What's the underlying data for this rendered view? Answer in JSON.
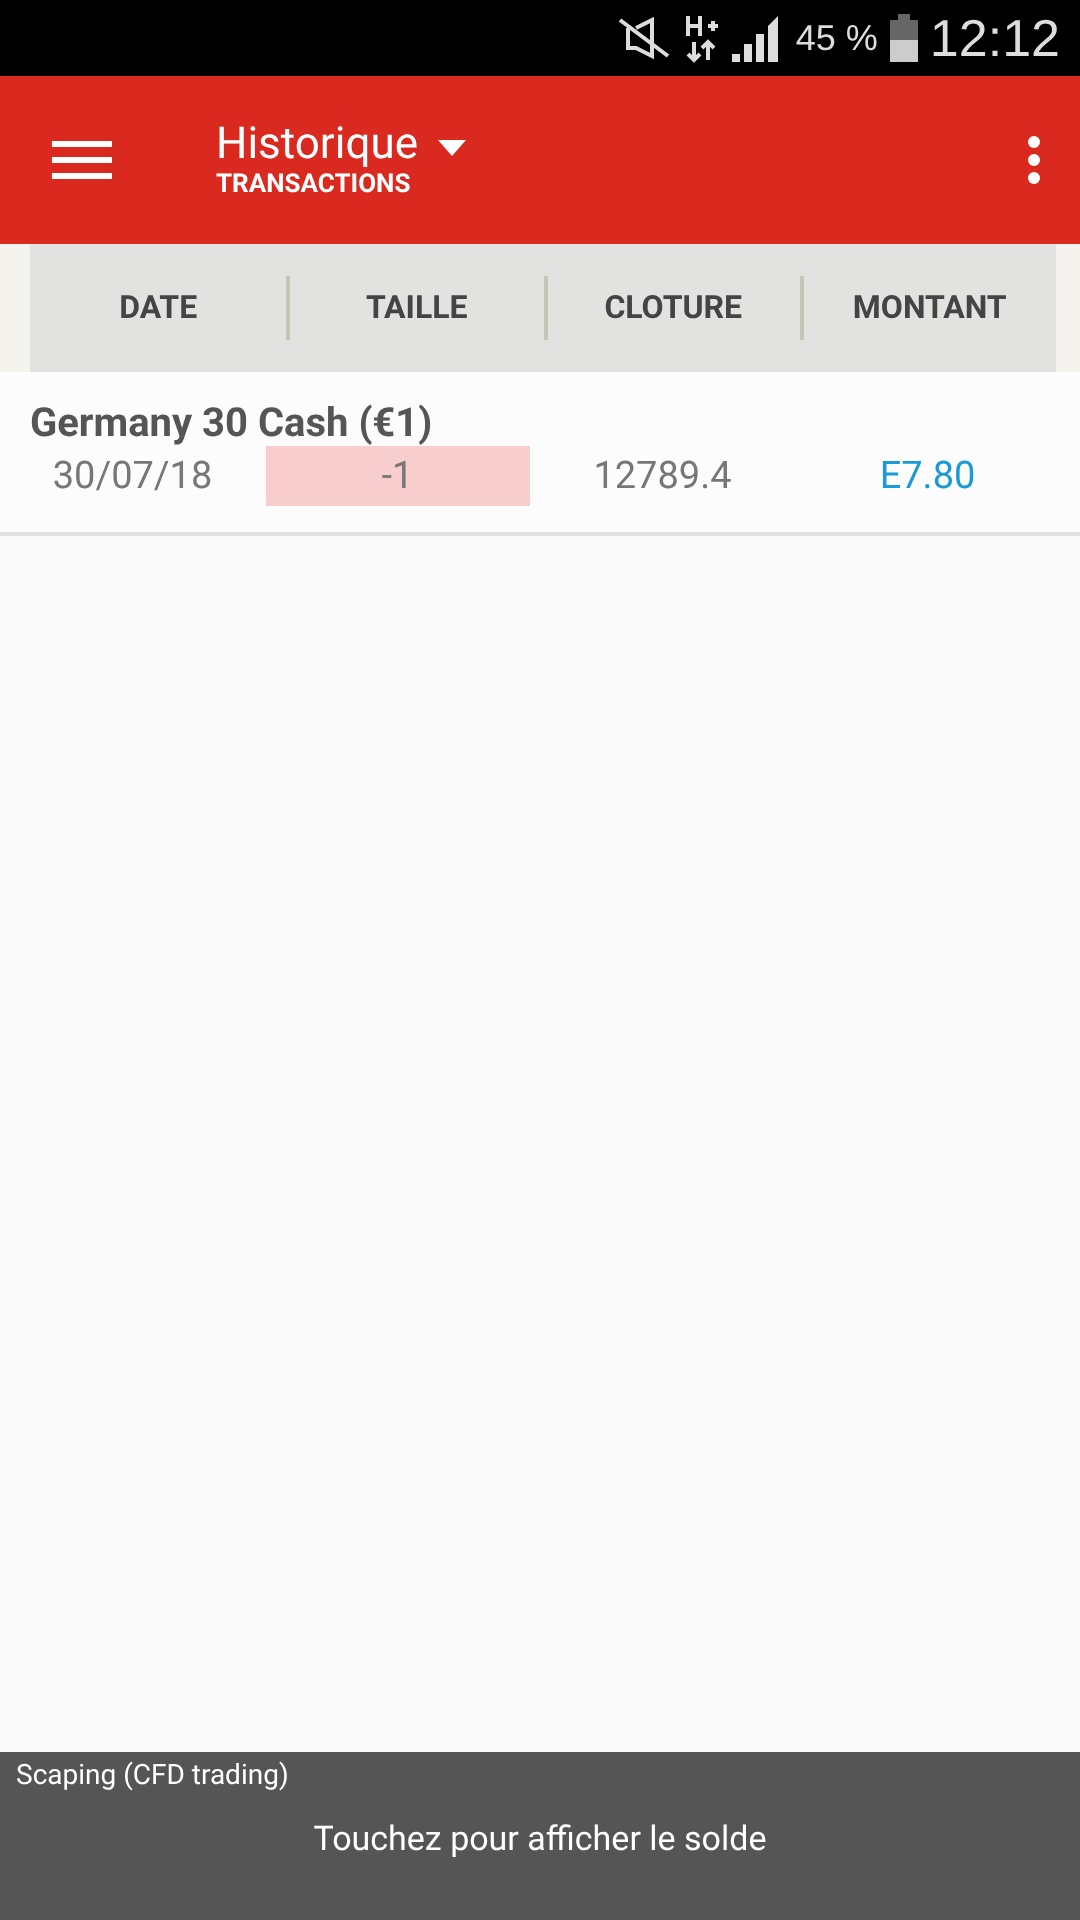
{
  "status_bar": {
    "battery": "45 %",
    "time": "12:12"
  },
  "app_bar": {
    "title": "Historique",
    "subtitle": "TRANSACTIONS"
  },
  "table": {
    "columns": [
      "DATE",
      "TAILLE",
      "CLOTURE",
      "MONTANT"
    ],
    "rows": [
      {
        "instrument": "Germany 30 Cash (€1)",
        "date": "30/07/18",
        "size": "-1",
        "short": true,
        "close": "12789.4",
        "amount": "E7.80"
      }
    ]
  },
  "footer": {
    "account": "Scaping (CFD trading)",
    "hint": "Touchez pour afficher le solde"
  }
}
